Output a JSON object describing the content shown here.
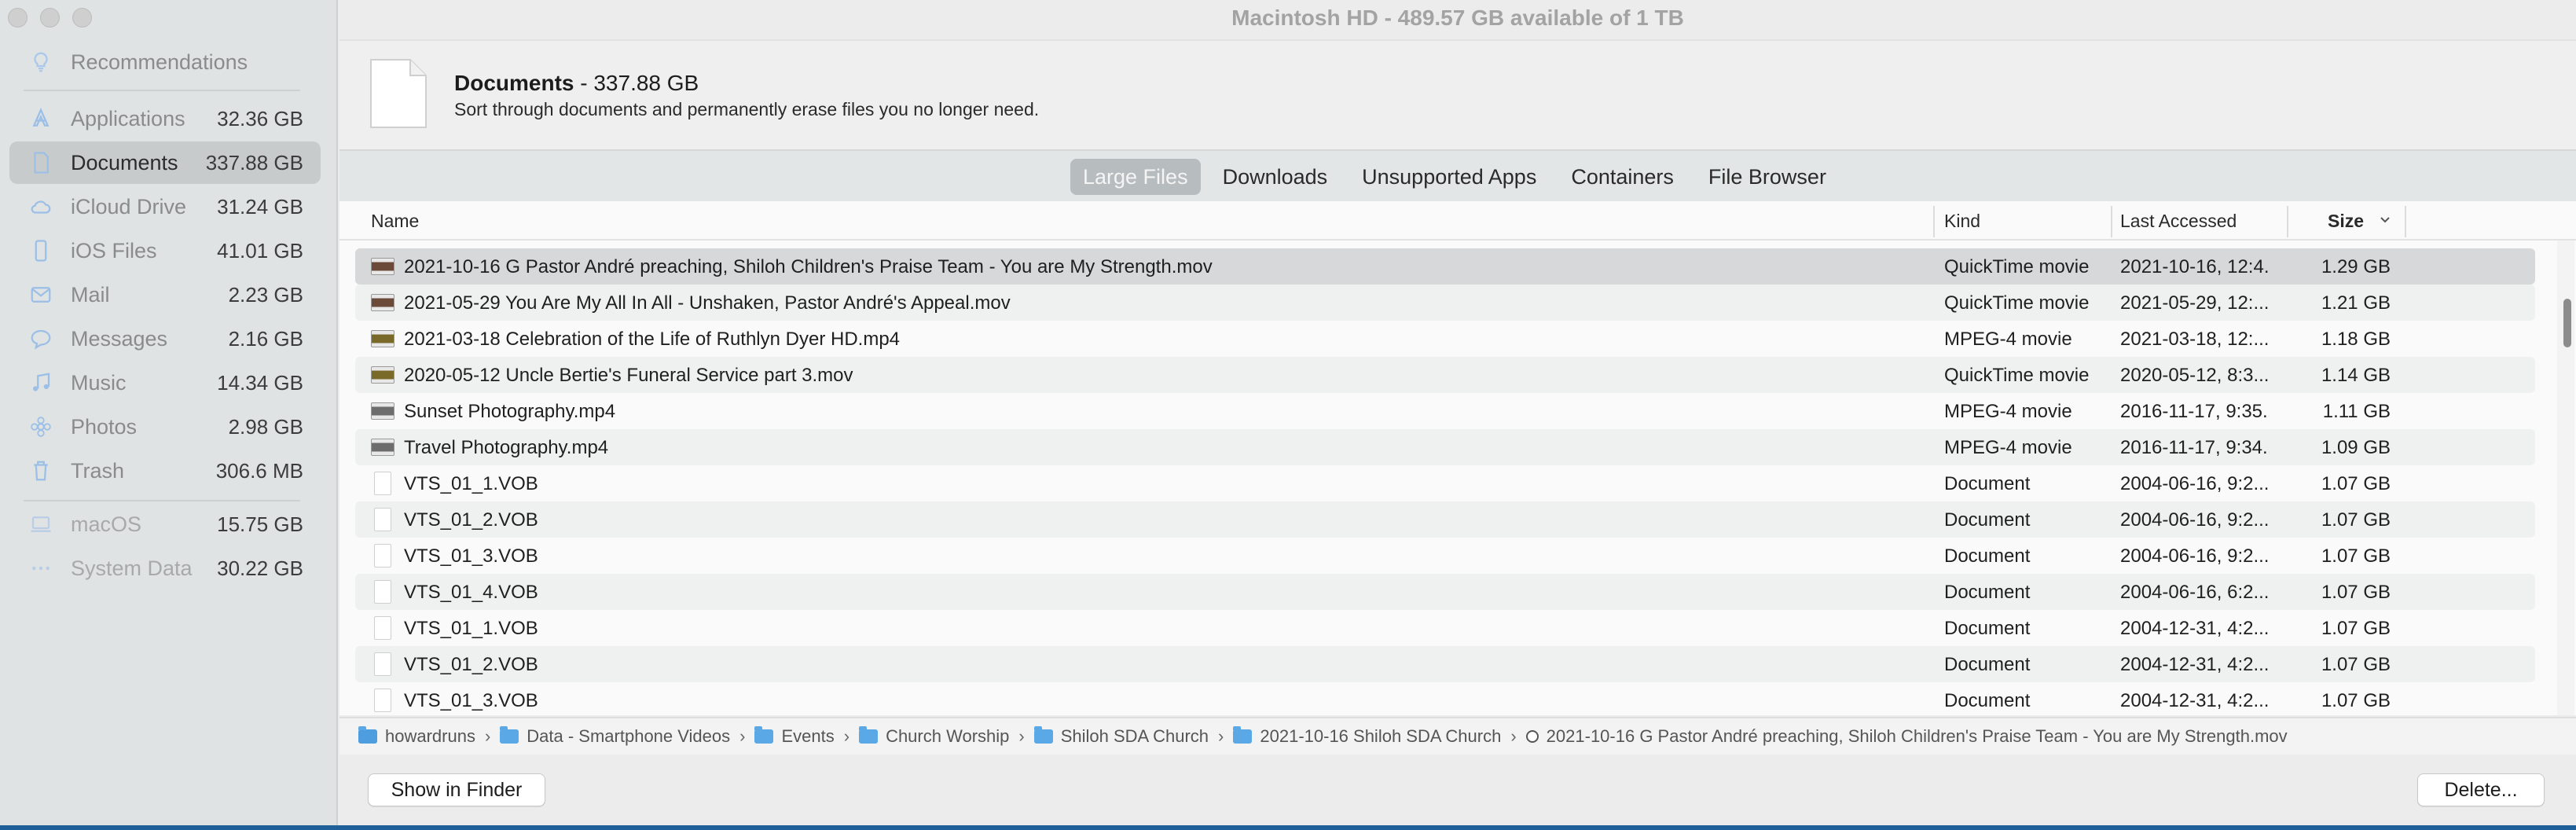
{
  "window_title": "Macintosh HD - 489.57 GB available of 1 TB",
  "sidebar": {
    "recommendations_label": "Recommendations",
    "items": [
      {
        "label": "Applications",
        "size": "32.36 GB",
        "icon": "applications-icon"
      },
      {
        "label": "Documents",
        "size": "337.88 GB",
        "icon": "document-icon"
      },
      {
        "label": "iCloud Drive",
        "size": "31.24 GB",
        "icon": "cloud-icon"
      },
      {
        "label": "iOS Files",
        "size": "41.01 GB",
        "icon": "phone-icon"
      },
      {
        "label": "Mail",
        "size": "2.23 GB",
        "icon": "envelope-icon"
      },
      {
        "label": "Messages",
        "size": "2.16 GB",
        "icon": "speech-bubble-icon"
      },
      {
        "label": "Music",
        "size": "14.34 GB",
        "icon": "music-note-icon"
      },
      {
        "label": "Photos",
        "size": "2.98 GB",
        "icon": "flower-icon"
      },
      {
        "label": "Trash",
        "size": "306.6 MB",
        "icon": "trash-icon"
      }
    ],
    "system_items": [
      {
        "label": "macOS",
        "size": "15.75 GB",
        "icon": "laptop-icon"
      },
      {
        "label": "System Data",
        "size": "30.22 GB",
        "icon": "ellipsis-icon"
      }
    ]
  },
  "header": {
    "title": "Documents",
    "size": " - 337.88 GB",
    "subtitle": "Sort through documents and permanently erase files you no longer need."
  },
  "tabs": [
    "Large Files",
    "Downloads",
    "Unsupported Apps",
    "Containers",
    "File Browser"
  ],
  "columns": {
    "name": "Name",
    "kind": "Kind",
    "last_accessed": "Last Accessed",
    "size": "Size"
  },
  "rows": [
    {
      "name": "2021-10-16 G Pastor André preaching, Shiloh Children's Praise Team - You are My Strength.mov",
      "kind": "QuickTime movie",
      "accessed": "2021-10-16, 12:4...",
      "size": "1.29 GB",
      "thumb": "video"
    },
    {
      "name": "2021-05-29 You Are My All In All - Unshaken, Pastor André's Appeal.mov",
      "kind": "QuickTime movie",
      "accessed": "2021-05-29, 12:...",
      "size": "1.21 GB",
      "thumb": "video"
    },
    {
      "name": "2021-03-18 Celebration of the Life of Ruthlyn Dyer HD.mp4",
      "kind": "MPEG-4 movie",
      "accessed": "2021-03-18, 12:...",
      "size": "1.18 GB",
      "thumb": "video b"
    },
    {
      "name": "2020-05-12 Uncle Bertie's Funeral Service part 3.mov",
      "kind": "QuickTime movie",
      "accessed": "2020-05-12, 8:3...",
      "size": "1.14 GB",
      "thumb": "video b"
    },
    {
      "name": "Sunset Photography.mp4",
      "kind": "MPEG-4 movie",
      "accessed": "2016-11-17, 9:35...",
      "size": "1.11 GB",
      "thumb": "video c"
    },
    {
      "name": "Travel Photography.mp4",
      "kind": "MPEG-4 movie",
      "accessed": "2016-11-17, 9:34...",
      "size": "1.09 GB",
      "thumb": "video c"
    },
    {
      "name": "VTS_01_1.VOB",
      "kind": "Document",
      "accessed": "2004-06-16, 9:2...",
      "size": "1.07 GB",
      "thumb": "doc"
    },
    {
      "name": "VTS_01_2.VOB",
      "kind": "Document",
      "accessed": "2004-06-16, 9:2...",
      "size": "1.07 GB",
      "thumb": "doc"
    },
    {
      "name": "VTS_01_3.VOB",
      "kind": "Document",
      "accessed": "2004-06-16, 9:2...",
      "size": "1.07 GB",
      "thumb": "doc"
    },
    {
      "name": "VTS_01_4.VOB",
      "kind": "Document",
      "accessed": "2004-06-16, 6:2...",
      "size": "1.07 GB",
      "thumb": "doc"
    },
    {
      "name": "VTS_01_1.VOB",
      "kind": "Document",
      "accessed": "2004-12-31, 4:2...",
      "size": "1.07 GB",
      "thumb": "doc"
    },
    {
      "name": "VTS_01_2.VOB",
      "kind": "Document",
      "accessed": "2004-12-31, 4:2...",
      "size": "1.07 GB",
      "thumb": "doc"
    },
    {
      "name": "VTS_01_3.VOB",
      "kind": "Document",
      "accessed": "2004-12-31, 4:2...",
      "size": "1.07 GB",
      "thumb": "doc"
    }
  ],
  "path": [
    {
      "label": "howardruns",
      "type": "home"
    },
    {
      "label": "Data - Smartphone Videos",
      "type": "folder"
    },
    {
      "label": "Events",
      "type": "folder"
    },
    {
      "label": "Church Worship",
      "type": "folder"
    },
    {
      "label": "Shiloh SDA Church",
      "type": "folder"
    },
    {
      "label": "2021-10-16 Shiloh SDA Church",
      "type": "folder"
    },
    {
      "label": "2021-10-16 G Pastor André preaching, Shiloh Children's Praise Team - You are My Strength.mov",
      "type": "mov"
    }
  ],
  "buttons": {
    "show_in_finder": "Show in Finder",
    "delete": "Delete..."
  }
}
